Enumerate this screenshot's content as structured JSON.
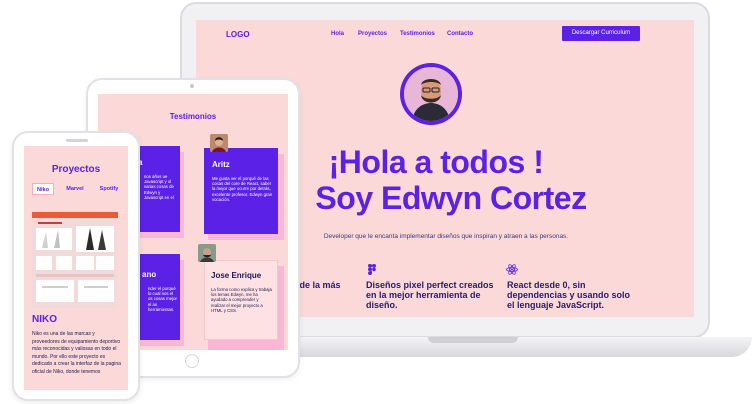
{
  "laptop": {
    "nav": {
      "logo": "LOGO",
      "links": [
        "Hola",
        "Proyectos",
        "Testimonios",
        "Contacto"
      ],
      "cta": "Descargar Curriculum"
    },
    "hero": {
      "line1": "¡Hola a todos !",
      "line2": "Soy Edwyn Cortez",
      "subtitle": "Developer que le encanta implementar diseños que inspiran y atraen a las personas."
    },
    "features": [
      {
        "text": "s de la más",
        "icon": ""
      },
      {
        "text": "Diseños pixel perfect creados en la mejor herramienta de diseño.",
        "icon": "figma-icon"
      },
      {
        "text": "React desde 0, sin dependencias y usando solo el lenguaje JavaScript.",
        "icon": "react-icon"
      }
    ]
  },
  "tablet": {
    "title": "Testimonios",
    "cards": [
      {
        "name": "Aritz",
        "text": "Me gusta ver el porqué de las cosas del core de React, saber la mejor que ocurre por detrás, excelente profesor. Edwyn gran vocación."
      },
      {
        "name": "Jose Enrique",
        "text": "La forma como explica y trabaja los temas Edwyn, me ha ayudado a comprender y realizar el mejor proyecto a HTML y CSS."
      },
      {
        "name": "ano",
        "text": "nder el porqué lo cual nos el os cosas mejor el as herramientas."
      },
      {
        "name": "a",
        "text": "nos años ue Javascript y ol varias cosas de Edwyn y Javascript en el"
      }
    ]
  },
  "phone": {
    "title": "Proyectos",
    "tabs": [
      "Niko",
      "Marvel",
      "Spotify"
    ],
    "project_name": "NIKO",
    "project_desc": "Niko es una de las marcas y proveedores de equipamiento deportivo más reconocidas y valiosas en todo el mundo. Por ello este proyecto es dedicado a crear la interfaz de la pagina oficial de Niko, donde tenemos"
  },
  "colors": {
    "accent": "#5b21e6",
    "background": "#fcd9d9",
    "card_shadow": "#f7b8d6"
  }
}
